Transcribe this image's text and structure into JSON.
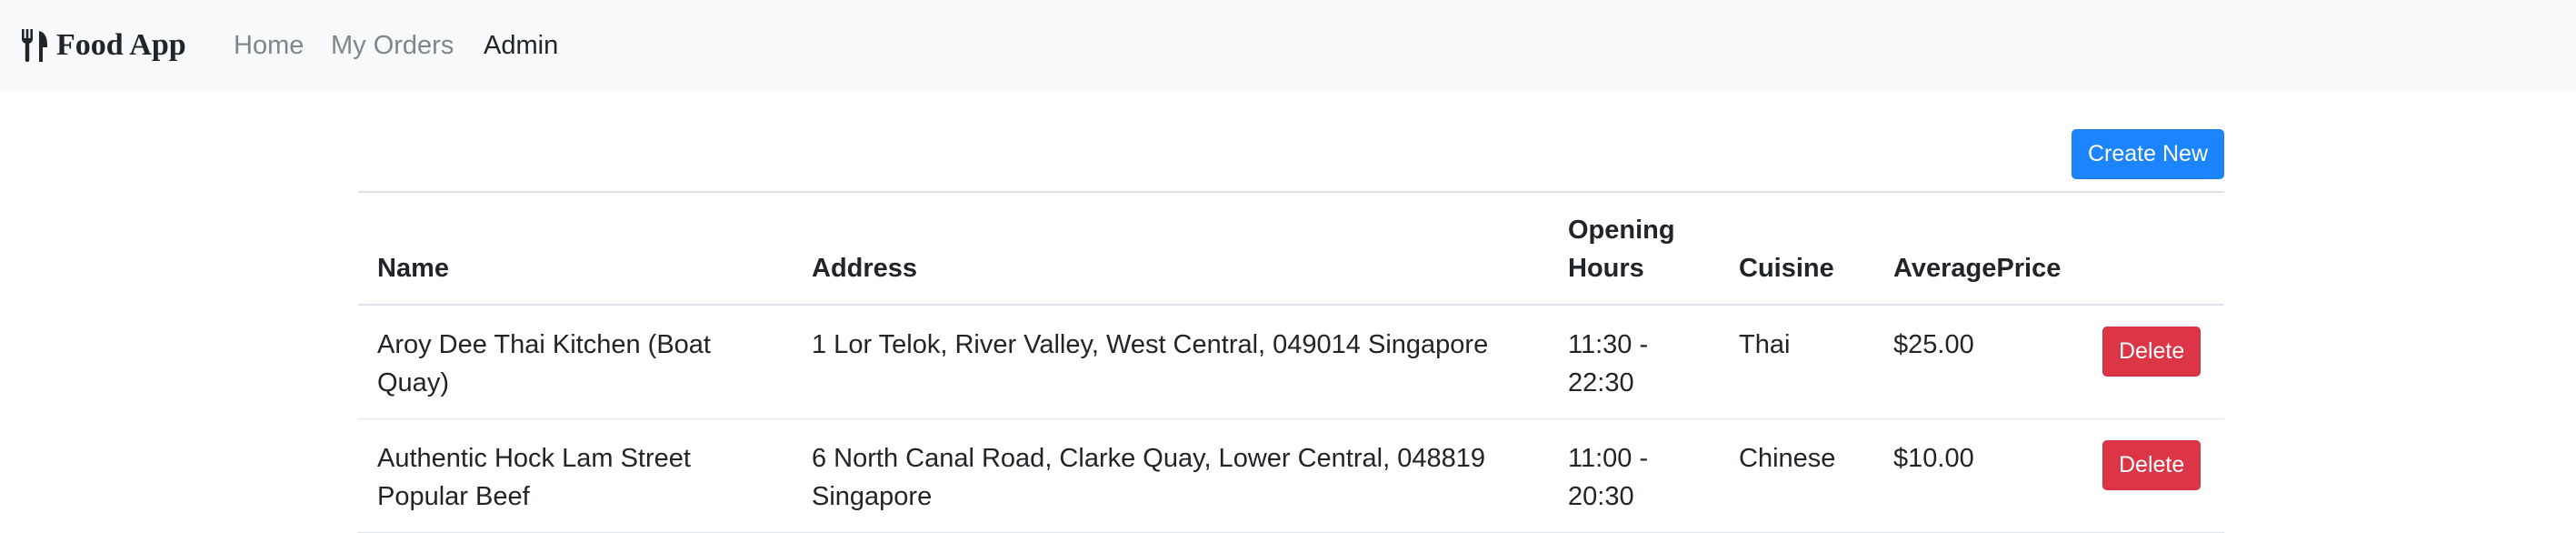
{
  "navbar": {
    "brand": "Food App",
    "brand_icon": "utensils-icon",
    "links": [
      {
        "label": "Home",
        "active": false
      },
      {
        "label": "My Orders",
        "active": false
      },
      {
        "label": "Admin",
        "active": true
      }
    ]
  },
  "toolbar": {
    "create_label": "Create New"
  },
  "table": {
    "headers": {
      "name": "Name",
      "address": "Address",
      "hours_line1": "Opening",
      "hours_line2": "Hours",
      "cuisine": "Cuisine",
      "price": "AveragePrice"
    },
    "rows": [
      {
        "name": "Aroy Dee Thai Kitchen (Boat Quay)",
        "address": "1 Lor Telok, River Valley, West Central, 049014 Singapore",
        "hours": "11:30 - 22:30",
        "cuisine": "Thai",
        "price": "$25.00",
        "action": "Delete"
      },
      {
        "name": "Authentic Hock Lam Street Popular Beef",
        "address": "6 North Canal Road, Clarke Quay, Lower Central, 048819 Singapore",
        "hours": "11:00 - 20:30",
        "cuisine": "Chinese",
        "price": "$10.00",
        "action": "Delete"
      }
    ]
  },
  "colors": {
    "navbar_bg": "#f8f9fa",
    "primary": "#1c84ff",
    "danger": "#dc3545",
    "muted_link": "#80868c",
    "text": "#212529",
    "border": "#dee2e6"
  }
}
